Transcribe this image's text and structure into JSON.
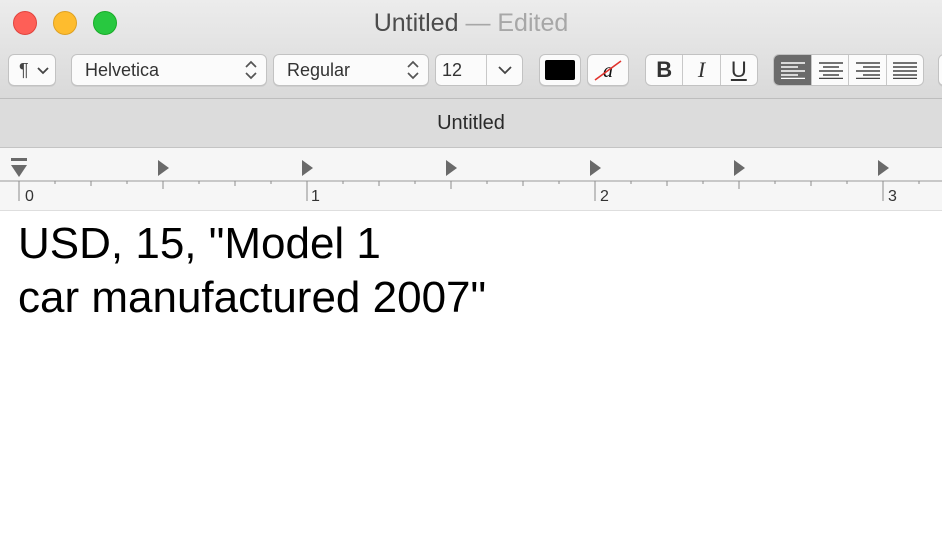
{
  "window": {
    "title": "Untitled",
    "edited_suffix": "— Edited"
  },
  "toolbar": {
    "paragraph_style_icon": "pilcrow-icon",
    "font_family": "Helvetica",
    "font_style": "Regular",
    "font_size": "12",
    "text_color": "#000000",
    "bold_label": "B",
    "italic_label": "I",
    "underline_label": "U"
  },
  "tab": {
    "title": "Untitled"
  },
  "ruler": {
    "labels": [
      "0",
      "1",
      "2",
      "3"
    ]
  },
  "document": {
    "lines": [
      "USD, 15, \"Model 1",
      "car manufactured 2007\""
    ]
  }
}
